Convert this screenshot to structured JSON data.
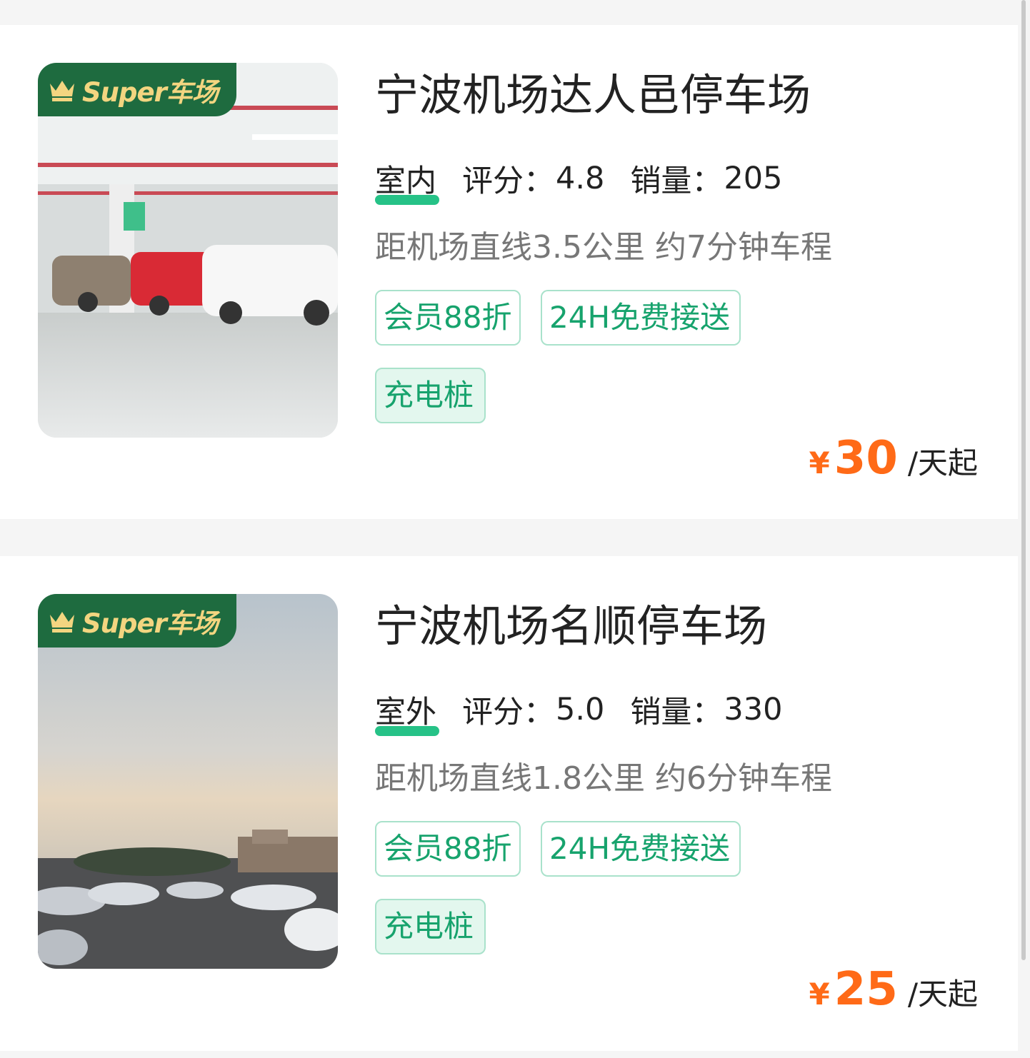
{
  "listings": [
    {
      "badge": "Super车场",
      "name": "宁波机场达人邑停车场",
      "type": "室内",
      "rating_label": "评分：",
      "rating": "4.8",
      "sales_label": "销量：",
      "sales": "205",
      "distance": "距机场直线3.5公里 约7分钟车程",
      "tags": [
        "会员88折",
        "24H免费接送",
        "充电桩"
      ],
      "currency": "¥",
      "price": "30",
      "price_unit": "/天起"
    },
    {
      "badge": "Super车场",
      "name": "宁波机场名顺停车场",
      "type": "室外",
      "rating_label": "评分：",
      "rating": "5.0",
      "sales_label": "销量：",
      "sales": "330",
      "distance": "距机场直线1.8公里 约6分钟车程",
      "tags": [
        "会员88折",
        "24H免费接送",
        "充电桩"
      ],
      "currency": "¥",
      "price": "25",
      "price_unit": "/天起"
    }
  ],
  "colors": {
    "accent_green": "#17a36d",
    "price_orange": "#ff6a17",
    "badge_green": "#1e6b3f",
    "badge_gold": "#f3d580"
  }
}
